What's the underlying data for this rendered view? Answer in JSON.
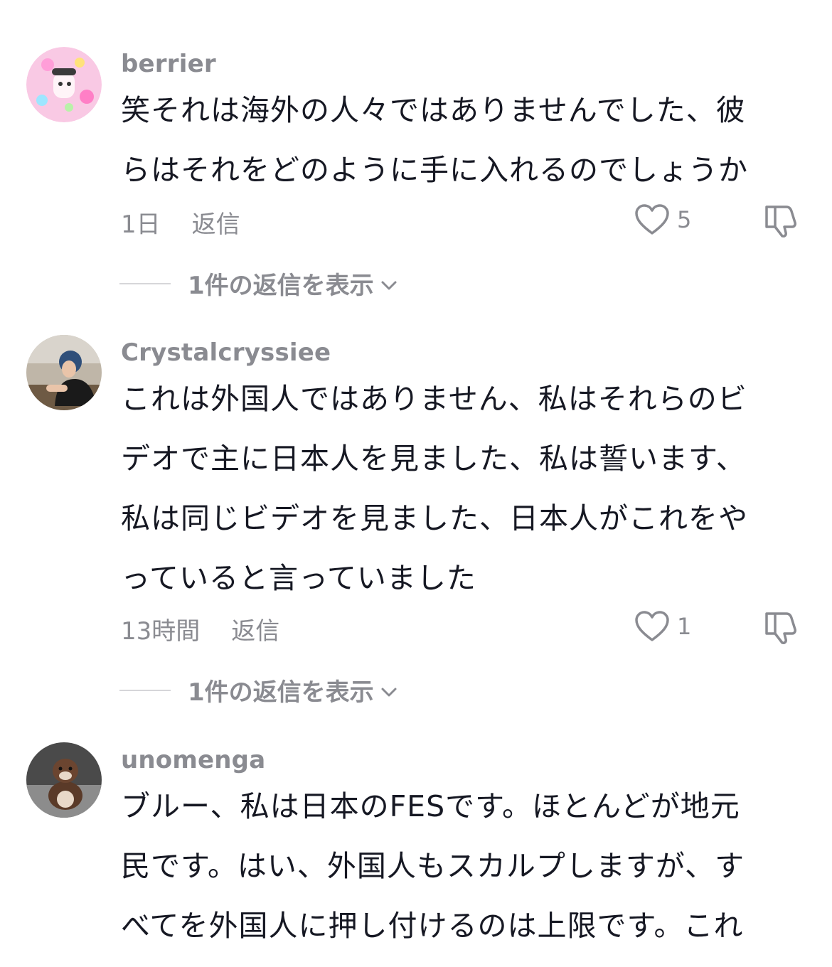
{
  "comments": [
    {
      "username": "berrier",
      "lines": [
        "笑それは海外の人々ではありませんでした、彼",
        "らはそれをどのように手に入れるのでしょうか"
      ],
      "time": "1日",
      "reply_label": "返信",
      "likes": "5",
      "view_replies": "1件の返信を表示"
    },
    {
      "username": "Crystalcryssiee",
      "lines": [
        "これは外国人ではありません、私はそれらのビ",
        "デオで主に日本人を見ました、私は誓います、",
        "私は同じビデオを見ました、日本人がこれをや",
        "っていると言っていました"
      ],
      "time": "13時間",
      "reply_label": "返信",
      "likes": "1",
      "view_replies": "1件の返信を表示"
    },
    {
      "username": "unomenga",
      "lines": [
        "ブルー、私は日本のFESです。ほとんどが地元",
        "民です。はい、外国人もスカルプしますが、す",
        "べてを外国人に押し付けるのは上限です。これ"
      ]
    }
  ],
  "icons": {
    "like": "heart-outline-icon",
    "dislike": "thumbs-down-icon",
    "expand": "chevron-down-icon"
  },
  "colors": {
    "text": "#161823",
    "secondary": "#8a8b91",
    "divider": "#d6d6d9"
  }
}
